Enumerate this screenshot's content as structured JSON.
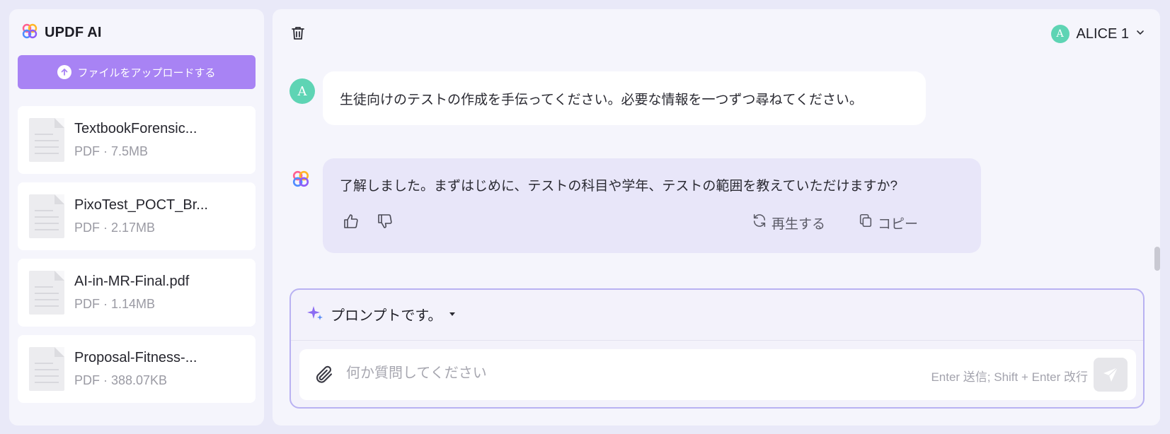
{
  "brand": {
    "name": "UPDF AI"
  },
  "sidebar": {
    "upload_label": "ファイルをアップロードする",
    "files": [
      {
        "name": "TextbookForensic...",
        "meta": "PDF · 7.5MB"
      },
      {
        "name": "PixoTest_POCT_Br...",
        "meta": "PDF · 2.17MB"
      },
      {
        "name": "AI-in-MR-Final.pdf",
        "meta": "PDF · 1.14MB"
      },
      {
        "name": "Proposal-Fitness-...",
        "meta": "PDF · 388.07KB"
      }
    ]
  },
  "header": {
    "user_initial": "A",
    "user_name": "ALICE 1"
  },
  "chat": {
    "user_message": "生徒向けのテストの作成を手伝ってください。必要な情報を一つずつ尋ねてください。",
    "ai_message": "了解しました。まずはじめに、テストの科目や学年、テストの範囲を教えていただけますか?",
    "regenerate_label": "再生する",
    "copy_label": "コピー"
  },
  "composer": {
    "prompt_label": "プロンプトです。",
    "placeholder": "何か質問してください",
    "hint": "Enter 送信; Shift + Enter 改行"
  },
  "colors": {
    "accent": "#a883f4",
    "avatar": "#5ed4b4",
    "ai_bubble": "#e8e6f9"
  },
  "icons": [
    "updf-logo-icon",
    "upload-arrow-icon",
    "pdf-file-icon",
    "trash-icon",
    "chevron-down-icon",
    "thumbs-up-icon",
    "thumbs-down-icon",
    "regenerate-icon",
    "copy-icon",
    "sparkle-icon",
    "caret-down-icon",
    "paperclip-icon",
    "send-icon"
  ]
}
